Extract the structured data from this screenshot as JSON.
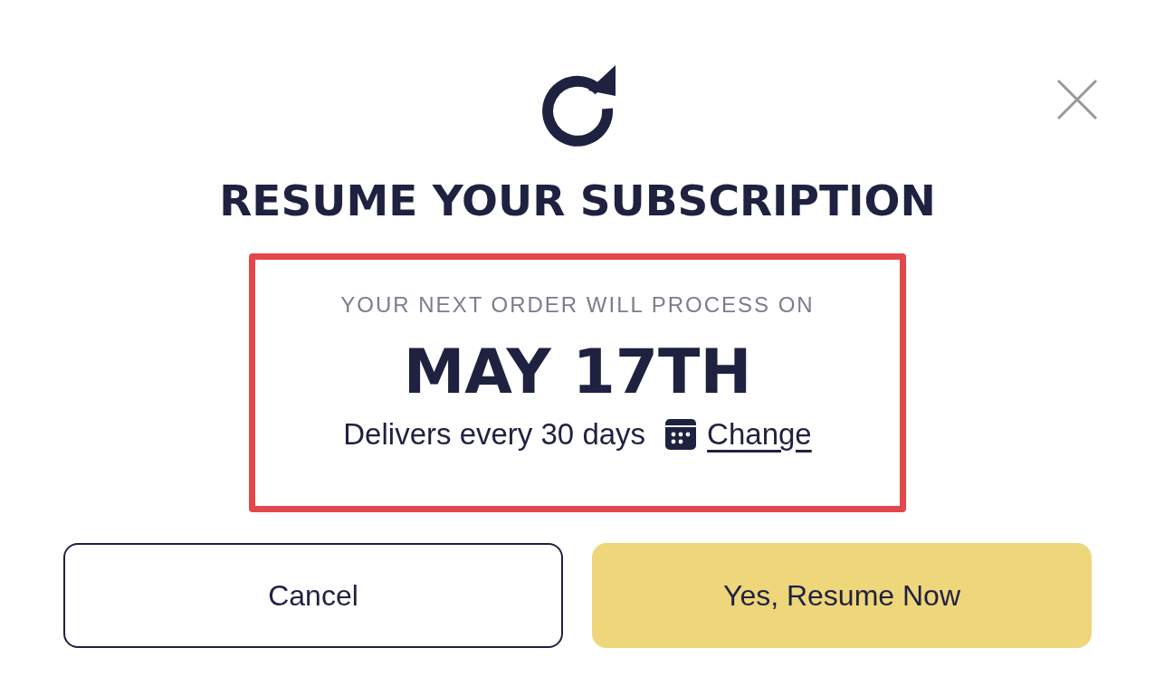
{
  "dialog": {
    "title": "RESUME YOUR SUBSCRIPTION",
    "next_order": {
      "label": "YOUR NEXT ORDER WILL PROCESS ON",
      "date": "MAY 17TH",
      "frequency": "Delivers every 30 days",
      "change_link": "Change"
    },
    "buttons": [
      {
        "label": "Cancel",
        "kind": "secondary"
      },
      {
        "label": "Yes, Resume Now",
        "kind": "primary"
      }
    ]
  }
}
